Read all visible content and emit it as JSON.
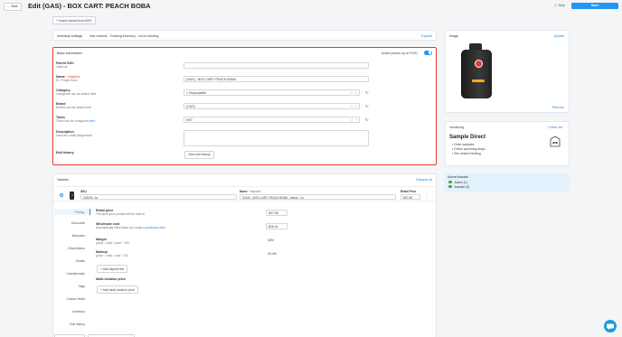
{
  "header": {
    "back_label": "Back",
    "title": "Edit (GAS) - BOX CART: PEACH BOBA",
    "help_label": "Help",
    "save_label": "Save",
    "import_label": "Import variant from BOS"
  },
  "inventory_settings": {
    "label": "Inventory settings",
    "value": "Has variants - Tracking inventory - No lot tracking",
    "expand_label": "Expand"
  },
  "basic_info": {
    "title": "Basic information",
    "active_label": "Active (shows up on POS)",
    "parent_sku": {
      "label": "Parent SKU",
      "sub": "Optional",
      "value": ""
    },
    "name": {
      "label": "Name",
      "req": "* required",
      "sub": "Ex. Purple Kush",
      "value": "(GAS) - BOX CART: PEACH BOBA"
    },
    "category": {
      "label": "Category",
      "sub": "Categories can be added",
      "link": "here",
      "value": "Disposables"
    },
    "brand": {
      "label": "Brand",
      "sub": "Brands can be added",
      "link": "here",
      "value": "(GAS)"
    },
    "taxes": {
      "label": "Taxes",
      "sub": "Taxes can be configured",
      "link": "here",
      "value": "HST"
    },
    "description": {
      "label": "Description",
      "sub": "Used for Leafly integrations",
      "value": ""
    },
    "edit_history": {
      "label": "Edit history",
      "button": "View edit history"
    }
  },
  "image_panel": {
    "title": "Image",
    "update_label": "Update",
    "remove_label": "Remove"
  },
  "sample_direct": {
    "introducing": "Introducing",
    "check_out": "Check out",
    "title": "Sample Direct",
    "items": [
      "Order samples",
      "Check upcoming drops",
      "See what's trending"
    ]
  },
  "active_inactive": {
    "title": "Active/Inactive",
    "items": [
      {
        "label": "Active (1)",
        "color": "#43a047"
      },
      {
        "label": "Inactive (0)",
        "color": "#43a047"
      }
    ]
  },
  "variants": {
    "title": "Variants",
    "collapse_label": "Collapse all",
    "sku_header": "SKU",
    "name_header": "Name",
    "name_req": "* required",
    "price_header": "Retail Price",
    "row": {
      "sku": "023294_1g____",
      "name": "(GAS) - BOX CART: PEACH BOBA - Indica - 1g",
      "price": "$37.98"
    },
    "tabs": [
      "Pricing",
      "Discounts",
      "Barcodes",
      "Descriptions",
      "Details",
      "Cannabinoids",
      "Tags",
      "Custom fields",
      "Inventory",
      "Edit history"
    ],
    "pricing": {
      "retail_label": "Retail price",
      "retail_sub": "The price your product will be sold at",
      "retail_value": "$37.98",
      "wholesale_label": "Wholesale cost",
      "wholesale_sub": "Automatically filled when you make a",
      "wholesale_link": "purchase order",
      "wholesale_value": "$26.41",
      "margin_label": "Margin",
      "margin_sub": "(price - cost) / price * 100",
      "margin_value": "33%",
      "markup_label": "Markup",
      "markup_sub": "(price - cost) / cost * 100",
      "markup_value": "49.4%",
      "deposit_button": "Add deposit fee",
      "multi_label": "Multi-location price",
      "multi_button": "Add multi-location price"
    }
  },
  "colors": {
    "accent": "#1e88e5",
    "highlight_border": "#e53935",
    "active_bg": "#e3f2fd"
  }
}
